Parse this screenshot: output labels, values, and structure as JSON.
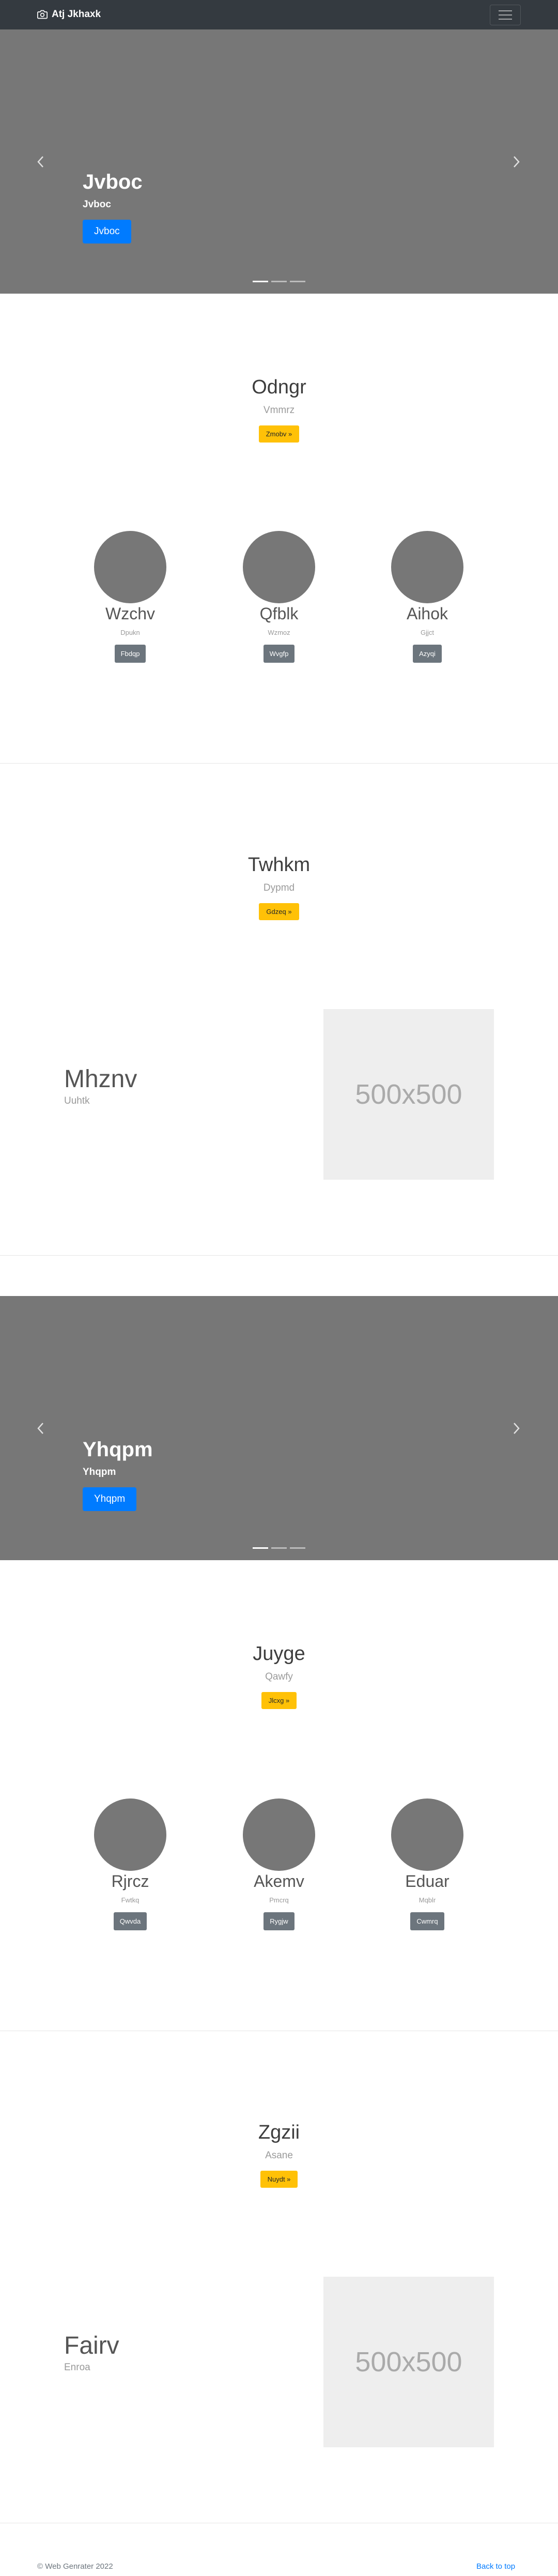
{
  "navbar": {
    "brand": "Atj Jkhaxk",
    "brand_icon": "camera-icon",
    "toggler_icon": "hamburger-icon"
  },
  "carousel1": {
    "title": "Jvboc",
    "subtitle": "Jvboc",
    "button": "Jvboc",
    "slides": 3,
    "active_slide": 1
  },
  "section1": {
    "heading": "Odngr",
    "subheading": "Vmmrz",
    "button": "Zmobv »"
  },
  "team1": [
    {
      "name": "Wzchv",
      "role": "Dpukn",
      "button": "Fbdqp"
    },
    {
      "name": "Qfblk",
      "role": "Wzmoz",
      "button": "Wvgfp"
    },
    {
      "name": "Aihok",
      "role": "Gjjct",
      "button": "Azyqi"
    }
  ],
  "section2": {
    "heading": "Twhkm",
    "subheading": "Dypmd",
    "button": "Gdzeq »"
  },
  "feature1": {
    "heading": "Mhznv",
    "subheading": "Uuhtk",
    "placeholder": "500x500"
  },
  "carousel2": {
    "title": "Yhqpm",
    "subtitle": "Yhqpm",
    "button": "Yhqpm",
    "slides": 3,
    "active_slide": 1
  },
  "section3": {
    "heading": "Juyge",
    "subheading": "Qawfy",
    "button": "Jlcxg »"
  },
  "team2": [
    {
      "name": "Rjrcz",
      "role": "Fwtkq",
      "button": "Qwvda"
    },
    {
      "name": "Akemv",
      "role": "Pmcrq",
      "button": "Rygjw"
    },
    {
      "name": "Eduar",
      "role": "Mqblr",
      "button": "Cwmrq"
    }
  ],
  "section4": {
    "heading": "Zgzii",
    "subheading": "Asane",
    "button": "Nuydt »"
  },
  "feature2": {
    "heading": "Fairv",
    "subheading": "Enroa",
    "placeholder": "500x500"
  },
  "footer": {
    "copyright": "© Web Genrater 2022",
    "back_to_top": "Back to top"
  },
  "colors": {
    "navbar": "#343a40",
    "carousel": "#777777",
    "primary": "#007bff",
    "warning": "#ffc107",
    "secondary": "#6c757d"
  }
}
